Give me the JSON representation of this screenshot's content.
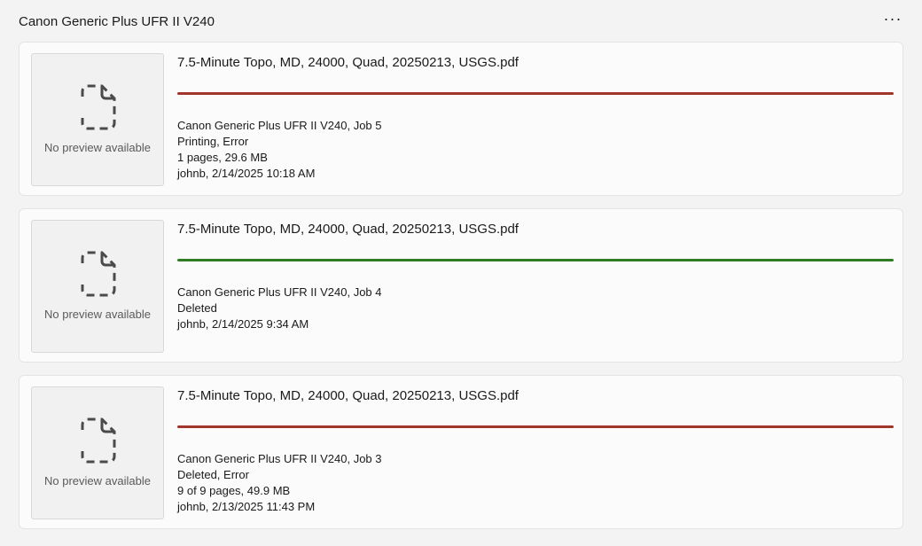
{
  "header": {
    "title": "Canon Generic Plus UFR II V240",
    "more_label": "···"
  },
  "jobs": [
    {
      "file_name": "7.5-Minute Topo, MD, 24000, Quad, 20250213, USGS.pdf",
      "preview_text": "No preview available",
      "status_color": "#a1342b",
      "printer_job": "Canon Generic Plus UFR II V240, Job 5",
      "status": "Printing, Error",
      "pages_size": "1 pages, 29.6 MB",
      "owner_time": "johnb, 2/14/2025 10:18 AM"
    },
    {
      "file_name": "7.5-Minute Topo, MD, 24000, Quad, 20250213, USGS.pdf",
      "preview_text": "No preview available",
      "status_color": "#2e7d22",
      "printer_job": "Canon Generic Plus UFR II V240, Job 4",
      "status": "Deleted",
      "owner_time": "johnb, 2/14/2025 9:34 AM"
    },
    {
      "file_name": "7.5-Minute Topo, MD, 24000, Quad, 20250213, USGS.pdf",
      "preview_text": "No preview available",
      "status_color": "#a1342b",
      "printer_job": "Canon Generic Plus UFR II V240, Job 3",
      "status": "Deleted, Error",
      "pages_size": "9 of 9 pages, 49.9 MB",
      "owner_time": "johnb, 2/13/2025 11:43 PM"
    }
  ]
}
